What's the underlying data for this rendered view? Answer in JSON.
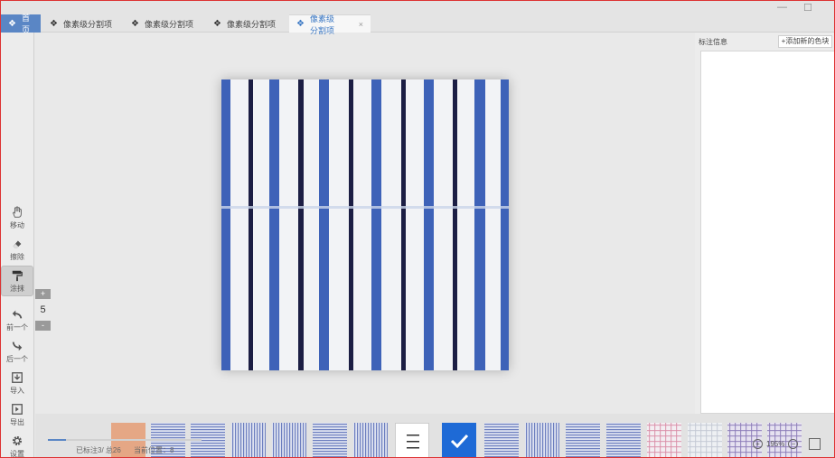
{
  "tabs": [
    {
      "label": "首页",
      "type": "home"
    },
    {
      "label": "像素级分割项",
      "type": "normal"
    },
    {
      "label": "像素级分割项",
      "type": "normal"
    },
    {
      "label": "像素级分割项",
      "type": "normal"
    },
    {
      "label": "像素级分割项",
      "type": "active",
      "close": "×"
    }
  ],
  "window_controls": {
    "minimize": "—",
    "maximize": "☐"
  },
  "tools": [
    {
      "label": "移动",
      "icon": "hand-icon"
    },
    {
      "label": "擦除",
      "icon": "eraser-icon"
    },
    {
      "label": "涂抹",
      "icon": "paint-roller-icon",
      "selected": true
    },
    {
      "label": "前一个",
      "icon": "undo-arrow-icon"
    },
    {
      "label": "后一个",
      "icon": "redo-arrow-icon"
    },
    {
      "label": "导入",
      "icon": "import-icon"
    },
    {
      "label": "导出",
      "icon": "export-icon"
    },
    {
      "label": "设置",
      "icon": "gear-icon"
    }
  ],
  "brush_size": {
    "value": "5",
    "plus": "+",
    "minus": "-"
  },
  "right_panel": {
    "title": "标注信息",
    "add_button": "+添加新的色块"
  },
  "status": {
    "labeled": "已标注3/ 总26",
    "position": "当前位置：8",
    "progress": 0.12
  },
  "zoom": {
    "value": "195%",
    "zoom_in": "+",
    "zoom_out": "−"
  },
  "thumbnails": [
    {
      "kind": "peach"
    },
    {
      "kind": "h-stripe"
    },
    {
      "kind": "h-stripe"
    },
    {
      "kind": "v-stripe"
    },
    {
      "kind": "v-stripe"
    },
    {
      "kind": "h-stripe"
    },
    {
      "kind": "v-stripe"
    },
    {
      "kind": "menu"
    },
    {
      "kind": "check"
    },
    {
      "kind": "h-stripe"
    },
    {
      "kind": "v-stripe"
    },
    {
      "kind": "h-stripe"
    },
    {
      "kind": "h-stripe"
    },
    {
      "kind": "plaid-pink"
    },
    {
      "kind": "plaid-light"
    },
    {
      "kind": "plaid-purple"
    },
    {
      "kind": "plaid-purple"
    }
  ],
  "colors": {
    "accent": "#5a86c5",
    "active_tab_text": "#3b78c4",
    "checked": "#1e6ad6",
    "stripe_blue": "#3e62b8",
    "stripe_navy": "#1c1e44",
    "peach": "#e5a785"
  }
}
